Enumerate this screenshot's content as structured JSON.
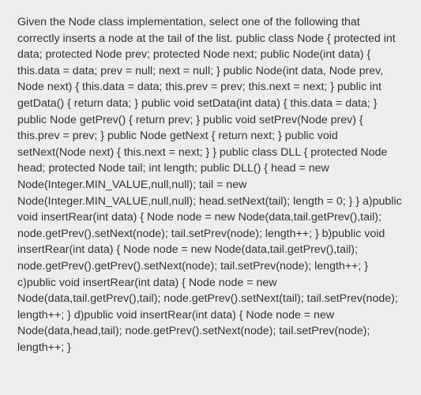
{
  "content": {
    "body": "Given the Node class implementation, select one of the following that correctly inserts a node at the tail of the list. public class Node { protected int data; protected Node prev; protected Node next; public Node(int data) { this.data = data; prev = null; next = null; } public Node(int data, Node prev, Node next) { this.data = data; this.prev = prev; this.next = next; } public int getData() { return data; } public void setData(int data) { this.data = data; } public Node getPrev() { return prev; } public void setPrev(Node prev) { this.prev = prev; } public Node getNext { return next; } public void setNext(Node next) { this.next = next; } } public class DLL { protected Node head; protected Node tail; int length; public DLL() { head = new Node(Integer.MIN_VALUE,null,null); tail = new Node(Integer.MIN_VALUE,null,null); head.setNext(tail); length = 0; } } a)public void insertRear(int data) { Node node = new Node(data,tail.getPrev(),tail); node.getPrev().setNext(node); tail.setPrev(node); length++; } b)public void insertRear(int data) { Node node = new Node(data,tail.getPrev(),tail); node.getPrev().getPrev().setNext(node); tail.setPrev(node); length++; } c)public void insertRear(int data) { Node node = new Node(data,tail.getPrev(),tail); node.getPrev().setNext(tail); tail.setPrev(node); length++; } d)public void insertRear(int data) { Node node = new Node(data,head,tail); node.getPrev().setNext(node); tail.setPrev(node); length++; }"
  }
}
